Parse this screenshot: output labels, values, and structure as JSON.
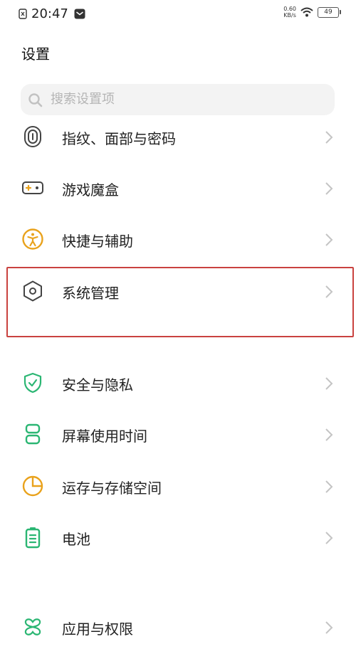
{
  "status_bar": {
    "time": "20:47",
    "net_speed_value": "0.60",
    "net_speed_unit": "KB/s",
    "battery_level": "49"
  },
  "header": {
    "title": "设置"
  },
  "search": {
    "placeholder": "搜索设置项"
  },
  "settings_items": [
    {
      "label": "指纹、面部与密码",
      "icon": "fingerprint-icon"
    },
    {
      "label": "游戏魔盒",
      "icon": "gamepad-icon"
    },
    {
      "label": "快捷与辅助",
      "icon": "accessibility-icon"
    },
    {
      "label": "系统管理",
      "icon": "hexagon-settings-icon",
      "highlighted": true
    },
    {
      "label": "安全与隐私",
      "icon": "shield-icon"
    },
    {
      "label": "屏幕使用时间",
      "icon": "hourglass-icon"
    },
    {
      "label": "运存与存储空间",
      "icon": "pie-chart-icon"
    },
    {
      "label": "电池",
      "icon": "battery-icon"
    },
    {
      "label": "应用与权限",
      "icon": "apps-icon"
    }
  ],
  "colors": {
    "icon_gray": "#444444",
    "icon_green": "#2bb673",
    "icon_yellow": "#e9a21c",
    "highlight_border": "#c9423f",
    "chevron": "#c4c4c4"
  }
}
